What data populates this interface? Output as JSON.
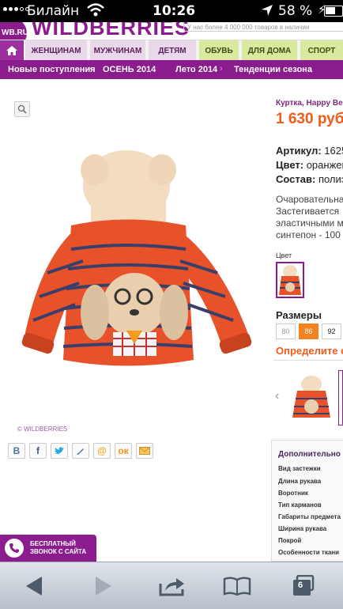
{
  "status_bar": {
    "carrier": "Билайн",
    "time": "10:26",
    "battery": "58 %"
  },
  "site": {
    "logo_text": "WB.RU",
    "brand": "WILDBERRIES",
    "search_placeholder": "У нас более 4 000 000 товаров в наличии"
  },
  "categories": [
    {
      "label": "ЖЕНЩИНАМ"
    },
    {
      "label": "МУЖЧИНАМ"
    },
    {
      "label": "ДЕТЯМ"
    },
    {
      "label": "ОБУВЬ"
    },
    {
      "label": "ДЛЯ ДОМА"
    },
    {
      "label": "СПОРТ"
    }
  ],
  "subnav": [
    {
      "label": "Новые поступления"
    },
    {
      "label": "ОСЕНЬ 2014"
    },
    {
      "label": "Лето 2014"
    },
    {
      "label": "Тенденции сезона"
    }
  ],
  "product": {
    "name": "Куртка, Happy Be",
    "price": "1 630 руб.",
    "watermark": "© WILDBERRIES",
    "article_label": "Артикул:",
    "article_value": "1625",
    "color_label": "Цвет:",
    "color_value": "оранжев",
    "composition_label": "Состав:",
    "composition_value": "полиэ",
    "description_lines": [
      "Очаровательна",
      "Застегивается",
      "эластичными м",
      "синтепон - 100"
    ],
    "color_section_label": "Цвет",
    "sizes_title": "Размеры",
    "sizes": [
      "80",
      "86",
      "92"
    ],
    "define_size_link": "Определите с"
  },
  "share_icons": [
    "vkontakte-icon",
    "facebook-icon",
    "twitter-icon",
    "livejournal-icon",
    "mailru-icon",
    "odnoklassniki-icon",
    "email-icon"
  ],
  "share_labels": {
    "vk": "В",
    "fb": "f",
    "ok": "ок"
  },
  "callback": {
    "line1": "БЕСПЛАТНЫЙ",
    "line2": "ЗВОНОК С САЙТА"
  },
  "details": {
    "title": "Дополнительно",
    "rows": [
      "Вид застежки",
      "Длина рукава",
      "Воротник",
      "Тип карманов",
      "Габариты предмета",
      "Ширина рукава",
      "Покрой",
      "Особенности ткани"
    ]
  },
  "browser": {
    "tab_count": "6"
  },
  "colors": {
    "brand_purple": "#8b1c8e",
    "price_orange": "#f05a1a",
    "size_active": "#f58220"
  }
}
